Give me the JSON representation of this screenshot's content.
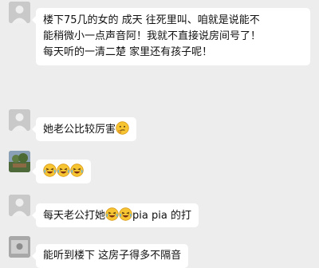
{
  "messages": [
    {
      "lines": [
        "楼下75几的女的 成天 往死里叫、咱就是说能不",
        "能稍微小一点声音阿！我就不直接说房间号了！",
        "每天听的一清二楚 家里还有孩子呢！"
      ]
    },
    {
      "text": "她老公比较厉害",
      "emoji": "thinking-face-icon"
    },
    {
      "emojis": [
        "laughing-face-icon",
        "laughing-face-icon",
        "laughing-face-icon"
      ]
    },
    {
      "text_before": "每天老公打她",
      "text_after": "pia  pia 的打",
      "emojis": [
        "laughing-face-icon",
        "laughing-face-icon"
      ]
    },
    {
      "text": "能听到楼下  这房子得多不隔音"
    }
  ],
  "colors": {
    "background": "#ededed",
    "bubble": "#ffffff",
    "text": "#111111",
    "avatar": "#c9c9c9"
  }
}
